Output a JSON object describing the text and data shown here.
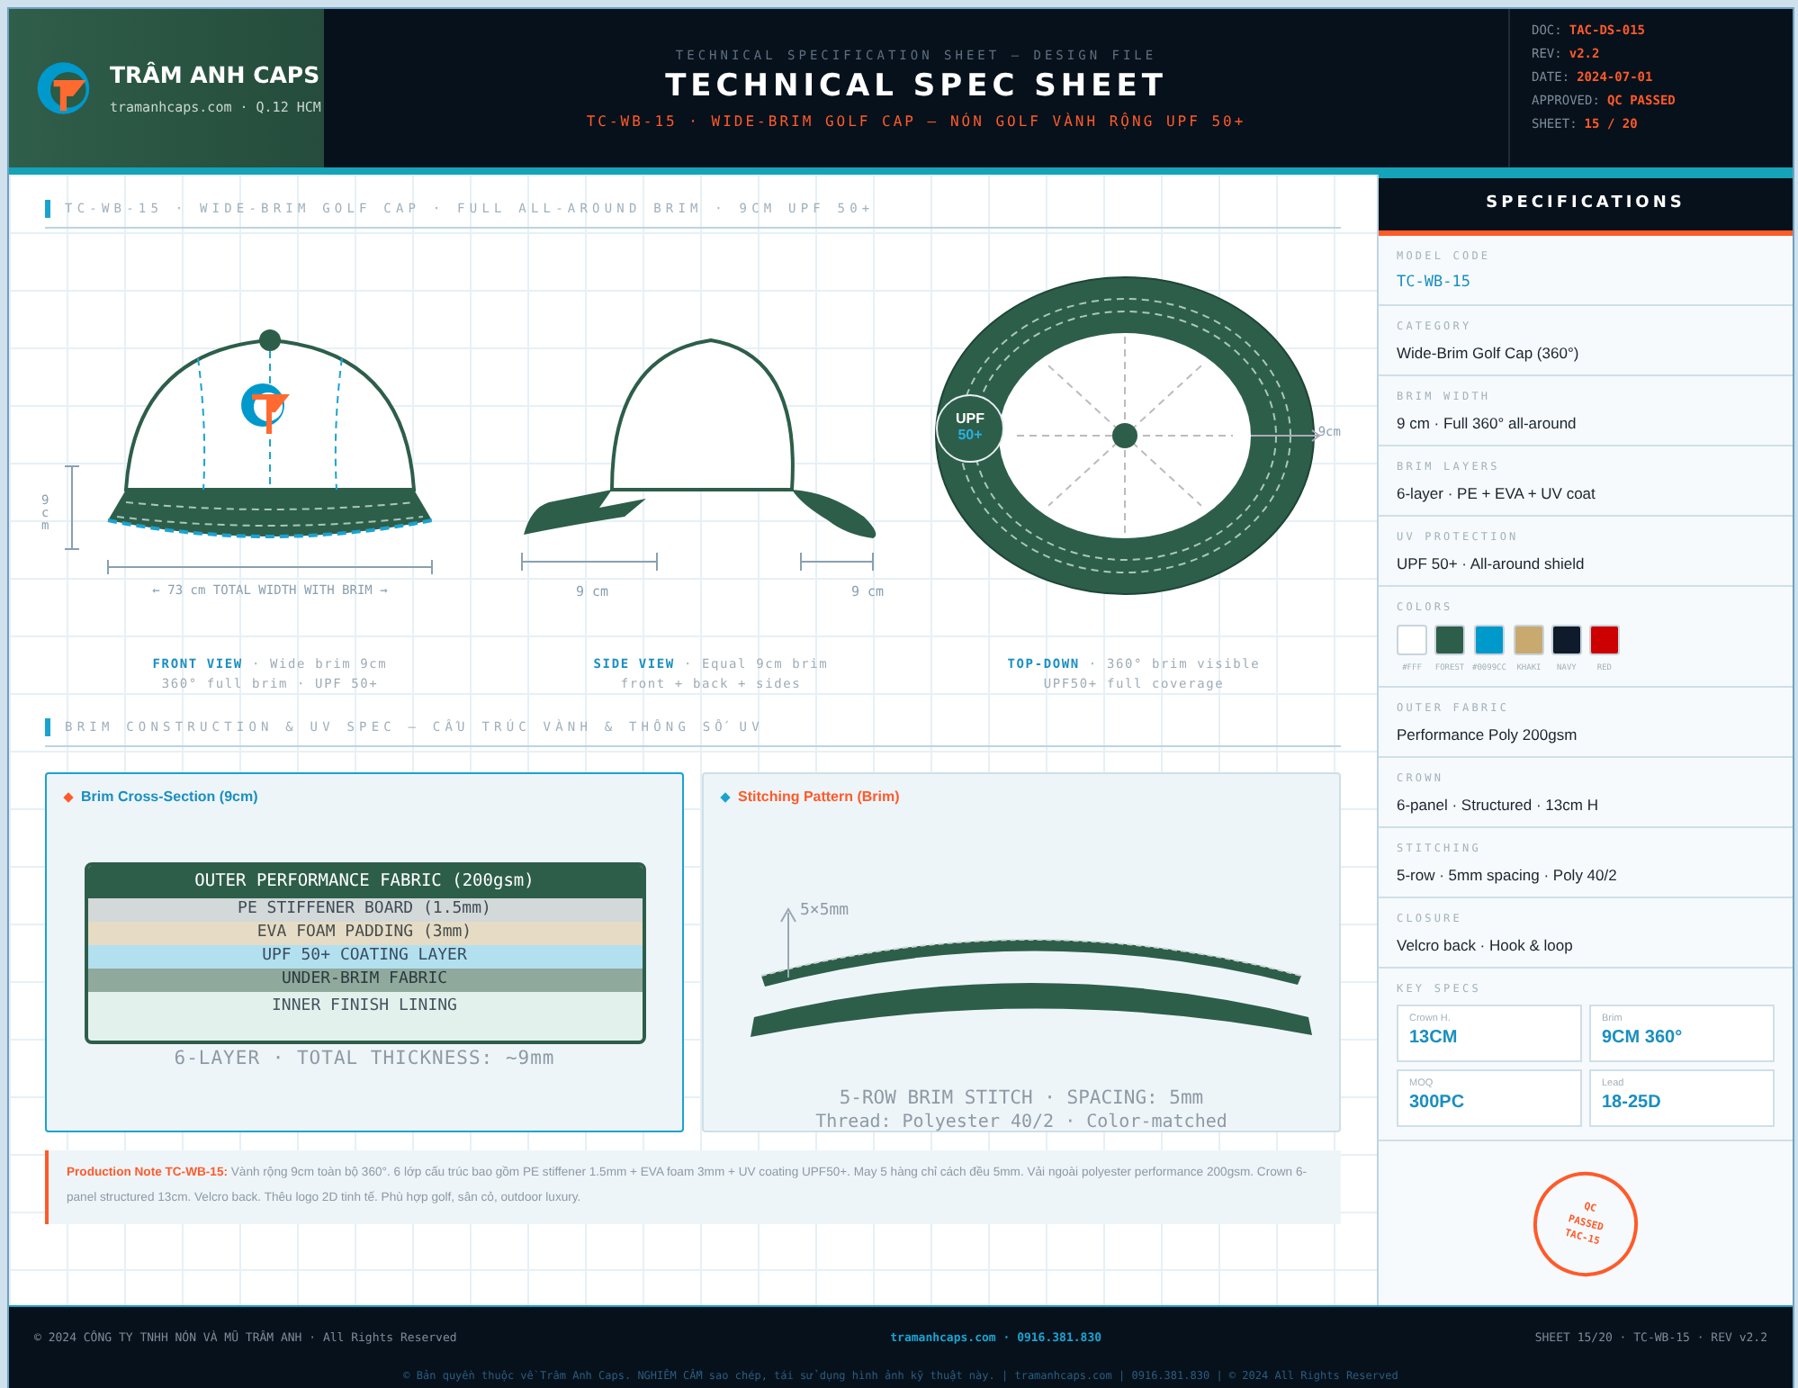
{
  "header": {
    "brand": "TRÂM ANH CAPS",
    "brand_sub": "tramanhcaps.com · Q.12 HCM",
    "kicker": "TECHNICAL SPECIFICATION SHEET — DESIGN FILE",
    "title": "TECHNICAL SPEC SHEET",
    "subtitle": "TC-WB-15 · WIDE-BRIM GOLF CAP — NÓN GOLF VÀNH RỘNG UPF 50+",
    "meta": [
      {
        "label": "DOC:",
        "value": "TAC-DS-015"
      },
      {
        "label": "REV:",
        "value": "v2.2"
      },
      {
        "label": "DATE:",
        "value": "2024-07-01"
      },
      {
        "label": "APPROVED:",
        "value": "QC PASSED"
      },
      {
        "label": "SHEET:",
        "value": "15 / 20"
      }
    ]
  },
  "views_section": {
    "title": "TC-WB-15 · WIDE-BRIM GOLF CAP · FULL ALL-AROUND BRIM · 9CM UPF 50+",
    "front": {
      "height_label": "9 cm",
      "width_label": "← 73 cm TOTAL WIDTH WITH BRIM →",
      "caption": "**FRONT VIEW** · Wide brim 9cm\n360° full brim · UPF 50+"
    },
    "side": {
      "front_label": "9 cm",
      "back_label": "9 cm",
      "caption": "**SIDE VIEW** · Equal 9cm brim\nfront + back + sides"
    },
    "top": {
      "badge_top": "UPF",
      "badge_bottom": "50+",
      "dim_label": "9cm",
      "caption": "**TOP-DOWN** · 360° brim visible\nUPF50+ full coverage"
    }
  },
  "brim_section": {
    "title": "BRIM CONSTRUCTION & UV SPEC — CẤU TRÚC VÀNH & THÔNG SỐ UV",
    "cross_section": {
      "title": "Brim Cross-Section (9cm)",
      "layers": [
        {
          "label": "OUTER PERFORMANCE FABRIC (200gsm)",
          "color": "#2d5e4a"
        },
        {
          "label": "PE STIFFENER BOARD (1.5mm)",
          "color": "#d3d8d9"
        },
        {
          "label": "EVA FOAM PADDING (3mm)",
          "color": "#e6dbc4"
        },
        {
          "label": "UPF 50+ COATING LAYER",
          "color": "#b3e0ef"
        },
        {
          "label": "UNDER-BRIM FABRIC",
          "color": "#8fa99d"
        },
        {
          "label": "INNER FINISH LINING",
          "color": "#e3f1ec"
        }
      ],
      "footer": "6-LAYER · TOTAL THICKNESS: ~9mm"
    },
    "stitching": {
      "title": "Stitching Pattern (Brim)",
      "dim_label": "5×5mm",
      "line1": "5-ROW BRIM STITCH · SPACING: 5mm",
      "line2": "Thread: Polyester 40/2 · Color-matched"
    },
    "note": "**Production Note TC-WB-15:** Vành rộng 9cm toàn bộ 360°. 6 lớp cấu trúc bao gồm PE stiffener 1.5mm + EVA foam 3mm + UV coating UPF50+. May 5 hàng chỉ cách đều 5mm. Vải ngoài polyester performance 200gsm. Crown 6-panel structured 13cm. Velcro back. Thêu logo 2D tinh tế. Phù hợp golf, sân cỏ, outdoor luxury."
  },
  "sidebar": {
    "title": "SPECIFICATIONS",
    "specs": [
      {
        "kind": "code",
        "label": "MODEL CODE",
        "value": "TC-WB-15"
      },
      {
        "kind": "text",
        "label": "CATEGORY",
        "value": "Wide-Brim Golf Cap (360°)"
      },
      {
        "kind": "text",
        "label": "BRIM WIDTH",
        "value": "9 cm · Full 360° all-around"
      },
      {
        "kind": "text",
        "label": "BRIM LAYERS",
        "value": "6-layer · PE + EVA + UV coat"
      },
      {
        "kind": "text",
        "label": "UV PROTECTION",
        "value": "UPF 50+ · All-around shield"
      },
      {
        "kind": "colors",
        "label": "COLORS",
        "swatches": [
          {
            "name": "#FFF",
            "color": "#ffffff"
          },
          {
            "name": "FOREST",
            "color": "#2d5e4a"
          },
          {
            "name": "#0099CC",
            "color": "#0099cc"
          },
          {
            "name": "KHAKI",
            "color": "#c8aa70"
          },
          {
            "name": "NAVY",
            "color": "#0f1a2b"
          },
          {
            "name": "RED",
            "color": "#cc0000"
          }
        ]
      },
      {
        "kind": "text",
        "label": "OUTER FABRIC",
        "value": "Performance Poly 200gsm"
      },
      {
        "kind": "text",
        "label": "CROWN",
        "value": "6-panel · Structured · 13cm H"
      },
      {
        "kind": "text",
        "label": "STITCHING",
        "value": "5-row · 5mm spacing · Poly 40/2"
      },
      {
        "kind": "text",
        "label": "CLOSURE",
        "value": "Velcro back · Hook & loop"
      },
      {
        "kind": "keys",
        "label": "KEY SPECS",
        "items": [
          {
            "label": "Crown H.",
            "value": "13CM"
          },
          {
            "label": "Brim",
            "value": "9CM 360°"
          },
          {
            "label": "MOQ",
            "value": "300PC"
          },
          {
            "label": "Lead",
            "value": "18-25D"
          }
        ]
      }
    ],
    "stamp": [
      "QC",
      "PASSED",
      "TAC-15"
    ]
  },
  "footer": {
    "left": "© 2024 CÔNG TY TNHH NÓN VÀ MŨ TRÂM ANH · All Rights Reserved",
    "center": "tramanhcaps.com · 0916.381.830",
    "right": "SHEET 15/20 · TC-WB-15 · REV v2.2",
    "legal": "© Bản quyền thuộc về Trâm Anh Caps. NGHIÊM CẤM sao chép, tái sử dụng hình ảnh kỹ thuật này. | tramanhcaps.com | 0916.381.830 | © 2024 All Rights Reserved"
  }
}
